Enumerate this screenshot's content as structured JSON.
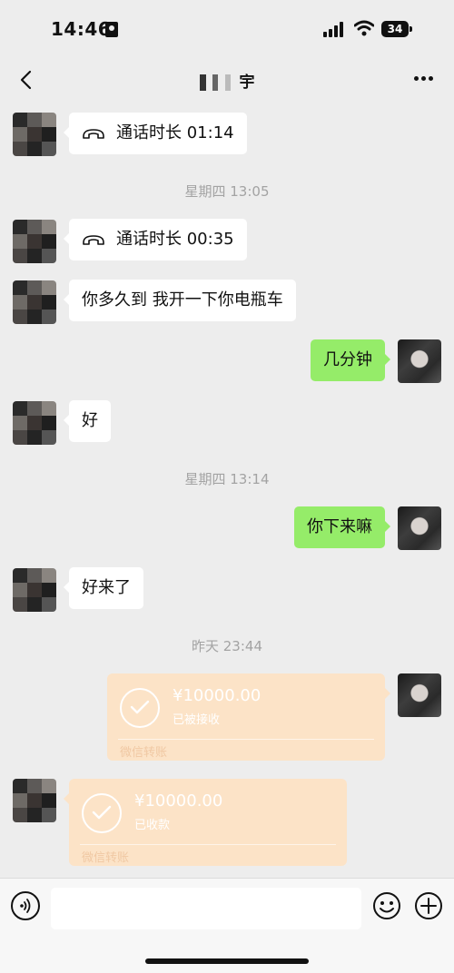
{
  "status_bar": {
    "time": "14:46",
    "battery": "34"
  },
  "header": {
    "title": "宇"
  },
  "messages": {
    "call1": {
      "label": "通话时长 01:14"
    },
    "ts1": "星期四 13:05",
    "call2": {
      "label": "通话时长 00:35"
    },
    "msg1": "你多久到 我开一下你电瓶车",
    "msg2": "几分钟",
    "msg3": "好",
    "ts2": "星期四 13:14",
    "msg4": "你下来嘛",
    "msg5": "好来了",
    "ts3": "昨天 23:44",
    "transfer_sent": {
      "amount": "¥10000.00",
      "status": "已被接收",
      "footer": "微信转账"
    },
    "transfer_received": {
      "amount": "¥10000.00",
      "status": "已收款",
      "footer": "微信转账"
    }
  },
  "colors": {
    "background": "#ededed",
    "bubble_self": "#95ec69",
    "bubble_other": "#ffffff",
    "transfer": "#fce3c7"
  }
}
